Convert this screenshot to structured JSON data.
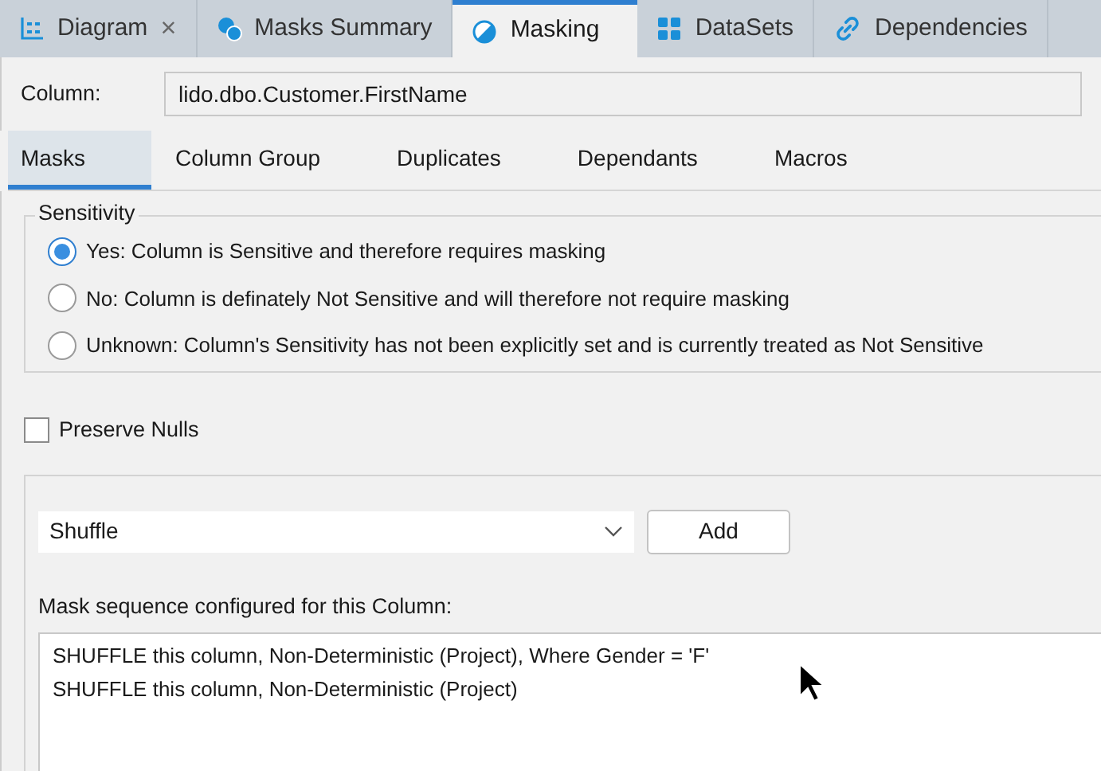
{
  "doc_tabs": [
    {
      "label": "Diagram",
      "kind": "diagram",
      "close": "×",
      "selected": false
    },
    {
      "label": "Masks Summary",
      "kind": "masks",
      "selected": false
    },
    {
      "label": "Masking",
      "kind": "masking",
      "selected": true
    },
    {
      "label": "DataSets",
      "kind": "datasets",
      "selected": false
    },
    {
      "label": "Dependencies",
      "kind": "link",
      "selected": false
    }
  ],
  "column": {
    "label": "Column:",
    "value": "lido.dbo.Customer.FirstName"
  },
  "sub_tabs": [
    {
      "label": "Masks",
      "selected": true
    },
    {
      "label": "Column Group",
      "selected": false
    },
    {
      "label": "Duplicates",
      "selected": false
    },
    {
      "label": "Dependants",
      "selected": false
    },
    {
      "label": "Macros",
      "selected": false
    }
  ],
  "sensitivity": {
    "title": "Sensitivity",
    "options": [
      {
        "label": "Yes: Column is Sensitive and therefore requires masking",
        "selected": true
      },
      {
        "label": "No: Column is definately Not Sensitive and will therefore not require masking",
        "selected": false
      },
      {
        "label": "Unknown: Column's Sensitivity has not been explicitly set and is currently treated as Not Sensitive",
        "selected": false
      }
    ]
  },
  "preserve_nulls": {
    "label": "Preserve Nulls",
    "checked": false
  },
  "mask_select": {
    "value": "Shuffle"
  },
  "add_button": "Add",
  "sequence": {
    "label": "Mask sequence configured for this Column:",
    "items": [
      "SHUFFLE this column, Non-Deterministic (Project), Where Gender = 'F'",
      "SHUFFLE this column, Non-Deterministic (Project)"
    ]
  }
}
